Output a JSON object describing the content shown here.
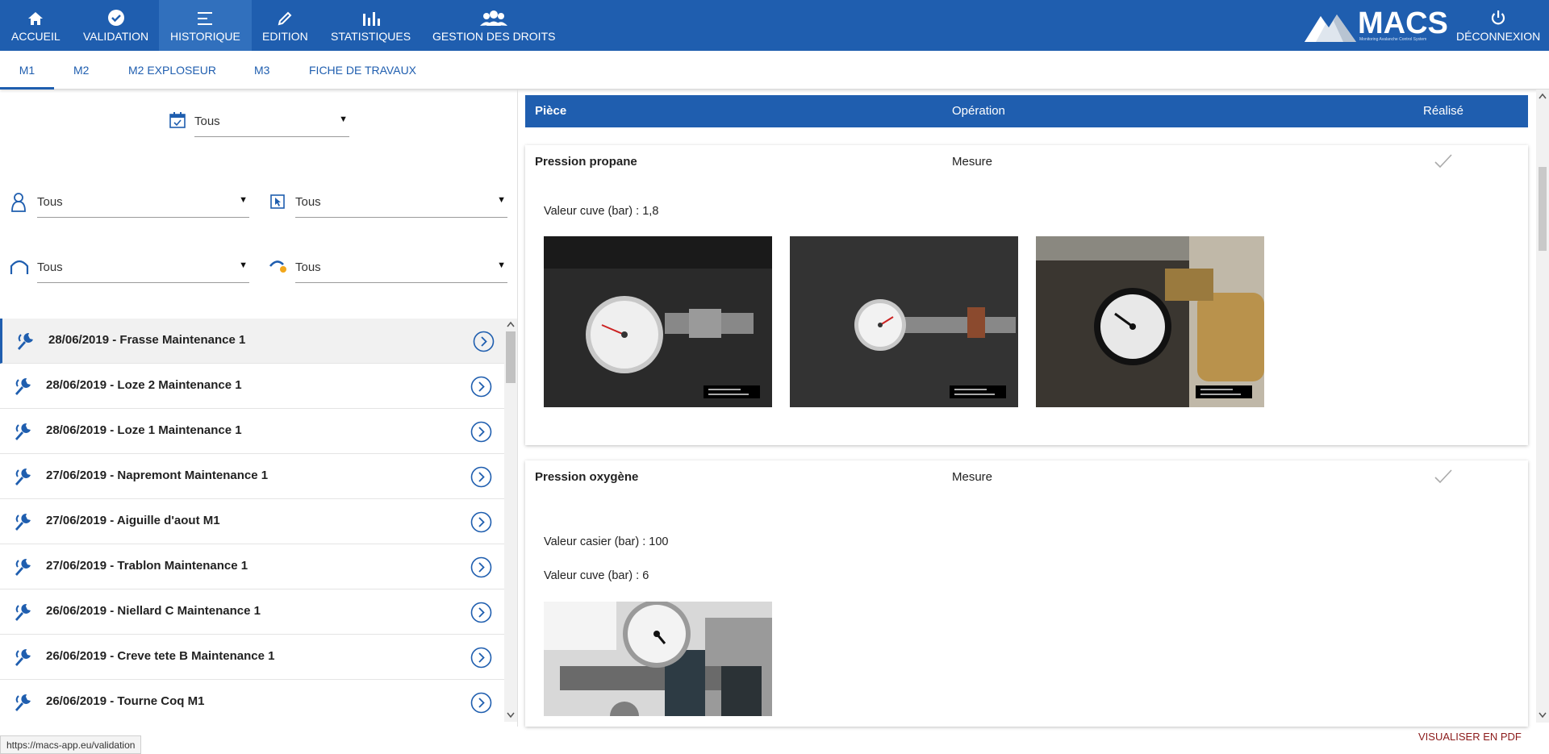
{
  "nav": {
    "items": [
      {
        "label": "ACCUEIL",
        "icon": "home-icon"
      },
      {
        "label": "VALIDATION",
        "icon": "check-circle-icon"
      },
      {
        "label": "HISTORIQUE",
        "icon": "list-icon"
      },
      {
        "label": "EDITION",
        "icon": "pencil-icon"
      },
      {
        "label": "STATISTIQUES",
        "icon": "bar-chart-icon"
      },
      {
        "label": "GESTION DES DROITS",
        "icon": "users-icon"
      }
    ],
    "logo": {
      "brand": "MACS",
      "tagline": "Monitoring Avalanche Control System"
    },
    "logout": {
      "label": "DÉCONNEXION",
      "icon": "power-icon"
    }
  },
  "subtabs": [
    "M1",
    "M2",
    "M2 EXPLOSEUR",
    "M3",
    "FICHE DE TRAVAUX"
  ],
  "filters": {
    "date": "Tous",
    "operator": "Tous",
    "device": "Tous",
    "site": "Tous",
    "intervention": "Tous"
  },
  "list": [
    "28/06/2019 - Frasse Maintenance 1",
    "28/06/2019 - Loze 2 Maintenance 1",
    "28/06/2019 - Loze 1 Maintenance 1",
    "27/06/2019 - Napremont Maintenance 1",
    "27/06/2019 - Aiguille d'aout M1",
    "27/06/2019 - Trablon Maintenance 1",
    "26/06/2019 - Niellard C Maintenance 1",
    "26/06/2019 - Creve tete B Maintenance 1",
    "26/06/2019 - Tourne Coq M1"
  ],
  "table": {
    "headers": {
      "piece": "Pièce",
      "operation": "Opération",
      "done": "Réalisé"
    },
    "rows": [
      {
        "piece": "Pression propane",
        "operation": "Mesure",
        "measures": [
          "Valeur cuve (bar) : 1,8"
        ]
      },
      {
        "piece": "Pression oxygène",
        "operation": "Mesure",
        "measures": [
          "Valeur casier (bar) : 100",
          "Valeur cuve (bar) : 6"
        ]
      }
    ]
  },
  "footer": {
    "pdf": "VISUALISER EN PDF",
    "status_url": "https://macs-app.eu/validation"
  },
  "colors": {
    "primary": "#1f5eaf",
    "pdf_link": "#8b1a1a"
  }
}
